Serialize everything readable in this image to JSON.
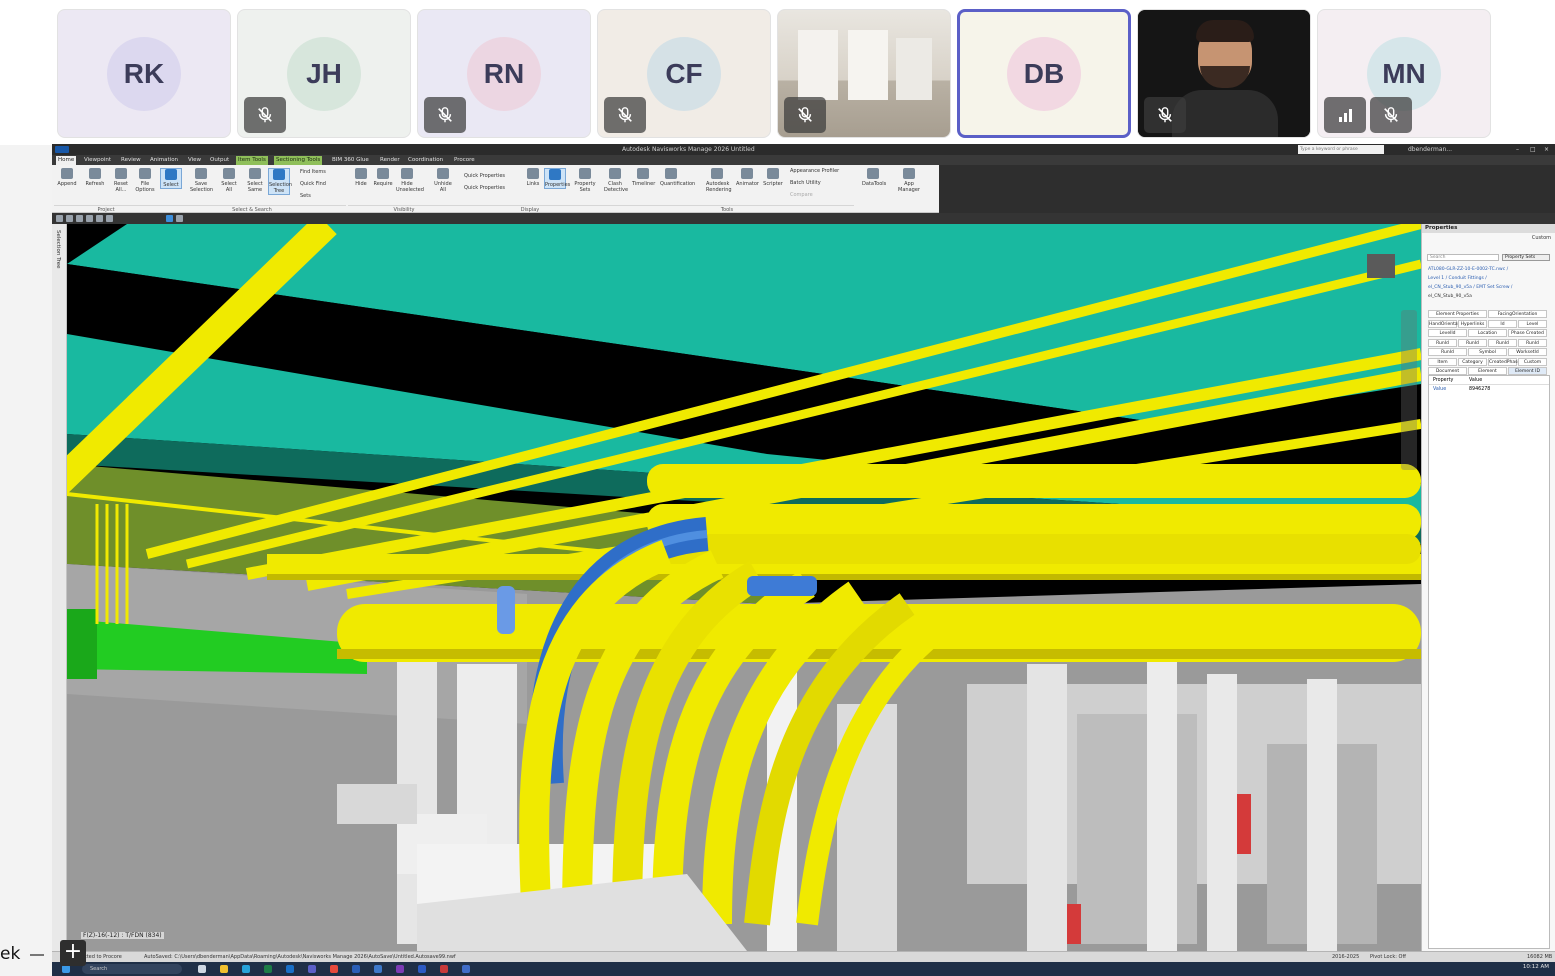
{
  "participants": [
    {
      "initials": "RK",
      "muted": false,
      "bg": "#ece8f3",
      "circle": "#dcd8ef",
      "active": false
    },
    {
      "initials": "JH",
      "muted": true,
      "bg": "#eef1ee",
      "circle": "#d7e6dc",
      "active": false
    },
    {
      "initials": "RN",
      "muted": true,
      "bg": "#eae8f4",
      "circle": "#ecd6e2",
      "active": false
    },
    {
      "initials": "CF",
      "muted": true,
      "bg": "#f1ece6",
      "circle": "#d5e1e6",
      "active": false
    },
    {
      "initials": "",
      "muted": true,
      "bg": "#d9d4cc",
      "circle": "",
      "video": "room",
      "active": false
    },
    {
      "initials": "DB",
      "muted": false,
      "bg": "#f6f4ea",
      "circle": "#f2d8e2",
      "active": true
    },
    {
      "initials": "",
      "muted": true,
      "bg": "#121212",
      "circle": "",
      "video": "avatar-man",
      "active": false
    },
    {
      "initials": "MN",
      "muted": true,
      "bg": "#f4eef2",
      "circle": "#d6e6ea",
      "active": false,
      "signal": true
    }
  ],
  "app": {
    "title": "Autodesk Navisworks Manage 2026   Untitled",
    "search_placeholder": "Type a keyword or phrase",
    "user": "dbenderman..."
  },
  "ribbon_tabs": [
    {
      "label": "Home",
      "state": "selected"
    },
    {
      "label": "Viewpoint",
      "state": ""
    },
    {
      "label": "Review",
      "state": ""
    },
    {
      "label": "Animation",
      "state": ""
    },
    {
      "label": "View",
      "state": ""
    },
    {
      "label": "Output",
      "state": ""
    },
    {
      "label": "Item Tools",
      "state": "context"
    },
    {
      "label": "Sectioning Tools",
      "state": "context"
    },
    {
      "label": "BIM 360 Glue",
      "state": ""
    },
    {
      "label": "Render",
      "state": ""
    },
    {
      "label": "Coordination",
      "state": ""
    },
    {
      "label": "Procore",
      "state": ""
    }
  ],
  "ribbon_buttons": [
    {
      "label": "Append",
      "on": false
    },
    {
      "label": "Refresh",
      "on": false
    },
    {
      "label": "Reset All...",
      "on": false
    },
    {
      "label": "File Options",
      "on": false
    },
    {
      "label": "Select",
      "on": true
    },
    {
      "label": "Save Selection",
      "on": false
    },
    {
      "label": "Select All",
      "on": false
    },
    {
      "label": "Select Same",
      "on": false
    },
    {
      "label": "Selection Tree",
      "on": true
    },
    {
      "label": "Hide",
      "on": false
    },
    {
      "label": "Require",
      "on": false
    },
    {
      "label": "Hide Unselected",
      "on": false
    },
    {
      "label": "Unhide All",
      "on": false
    },
    {
      "label": "Links",
      "on": false
    },
    {
      "label": "Properties",
      "on": true
    },
    {
      "label": "Property Sets",
      "on": false
    },
    {
      "label": "Clash Detective",
      "on": false
    },
    {
      "label": "Timeliner",
      "on": false
    },
    {
      "label": "Quantification",
      "on": false
    },
    {
      "label": "Autodesk Rendering",
      "on": false
    },
    {
      "label": "Animator",
      "on": false
    },
    {
      "label": "Scripter",
      "on": false
    },
    {
      "label": "DataTools",
      "on": false
    },
    {
      "label": "App Manager",
      "on": false
    }
  ],
  "ribbon_small": {
    "find_items": "Find Items",
    "quick_find": "Quick Find",
    "sets": "Sets",
    "quick_properties": "Quick Properties",
    "quick_properties_dd": "Quick Properties",
    "appearance_profiler": "Appearance Profiler",
    "batch_utility": "Batch Utility",
    "compare": "Compare"
  },
  "ribbon_groups": [
    "Project",
    "Select & Search",
    "Visibility",
    "Display",
    "Tools"
  ],
  "viewport": {
    "coord": "F(Z)-16(-12) : T/FDN (834)"
  },
  "properties_panel": {
    "title": "Properties",
    "mode": "Custom",
    "search_placeholder": "Search",
    "sets_label": "Property Sets",
    "path_lines": [
      "ATL080-GLR-ZZ-10-E-0002-TC.nwc /",
      "Level 1 / Conduit Fittings /",
      "el_CN_Stub_90_v5a / EMT Set Screw /",
      "el_CN_Stub_90_v5a"
    ],
    "tab_rows": [
      [
        "Element Properties",
        "FacingOrientation"
      ],
      [
        "HandOrientation",
        "Hyperlinks",
        "Id",
        "Level"
      ],
      [
        "LevelId",
        "Location",
        "Phase Created"
      ],
      [
        "RunId",
        "RunId",
        "RunId",
        "RunId"
      ],
      [
        "RunId",
        "Symbol",
        "WorksetId"
      ],
      [
        "Item",
        "Category",
        "CreatedPhaseId",
        "Custom"
      ],
      [
        "Document",
        "Element",
        "Element ID"
      ]
    ],
    "table_headers": [
      "Property",
      "Value"
    ],
    "table_rows": [
      [
        "Value",
        "8946278"
      ]
    ]
  },
  "status_bar": {
    "connection": "Connected to Procore",
    "autosave": "AutoSaved: C:\\Users\\dbenderman\\AppData\\Roaming\\Autodesk\\Navisworks Manage 2026\\AutoSave\\Untitled.Autosave99.nwf",
    "range": "2016-2025",
    "pivot": "Pivot Lock: Off",
    "memory": "16082 MB"
  },
  "taskbar": {
    "search": "Search",
    "time": "10:12 AM"
  },
  "zoom_control": {
    "label": "ek"
  },
  "colors": {
    "ceiling": "#19b9a0",
    "conduit": "#f0ea00",
    "conduit_dark": "#b7ad00",
    "bend_blue": "#2f6ec8",
    "duct_green": "#22cc22",
    "olive_wall": "#6f8f2a",
    "active_ring": "#5b5fc7"
  }
}
